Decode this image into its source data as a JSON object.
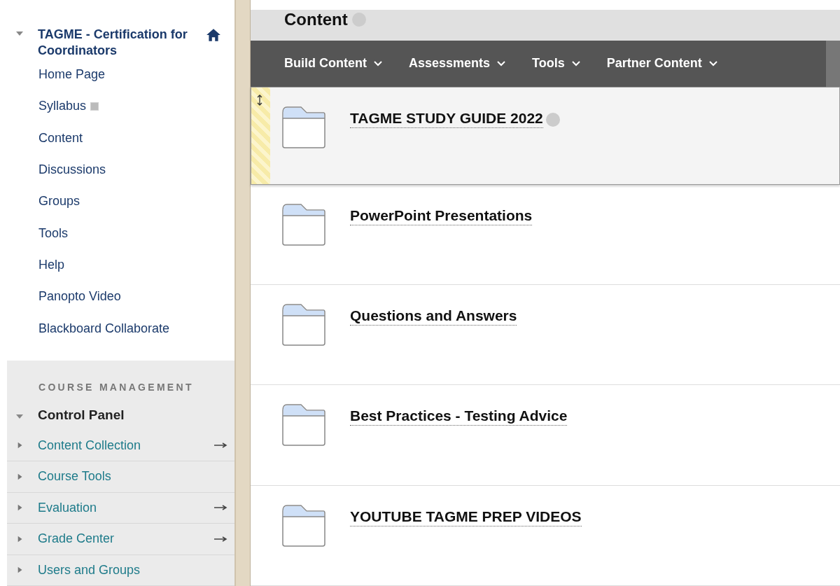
{
  "course": {
    "title": "TAGME - Certification for Coordinators",
    "expanded": true
  },
  "menu": [
    {
      "label": "Home Page",
      "marked": false
    },
    {
      "label": "Syllabus",
      "marked": true
    },
    {
      "label": "Content",
      "marked": false
    },
    {
      "label": "Discussions",
      "marked": false
    },
    {
      "label": "Groups",
      "marked": false
    },
    {
      "label": "Tools",
      "marked": false
    },
    {
      "label": "Help",
      "marked": false
    },
    {
      "label": "Panopto Video",
      "marked": false
    },
    {
      "label": "Blackboard Collaborate",
      "marked": false
    }
  ],
  "management": {
    "heading": "COURSE MANAGEMENT",
    "panel": {
      "label": "Control Panel",
      "expanded": true
    },
    "items": [
      {
        "label": "Content Collection",
        "expanded": false,
        "arrow": true
      },
      {
        "label": "Course Tools",
        "expanded": false,
        "arrow": false
      },
      {
        "label": "Evaluation",
        "expanded": false,
        "arrow": true
      },
      {
        "label": "Grade Center",
        "expanded": false,
        "arrow": true
      },
      {
        "label": "Users and Groups",
        "expanded": false,
        "arrow": false
      }
    ]
  },
  "page_title": "Content",
  "toolbar": [
    {
      "label": "Build Content"
    },
    {
      "label": "Assessments"
    },
    {
      "label": "Tools"
    },
    {
      "label": "Partner Content"
    }
  ],
  "items": [
    {
      "title": "TAGME STUDY GUIDE 2022",
      "selected": true
    },
    {
      "title": "PowerPoint Presentations",
      "selected": false
    },
    {
      "title": "Questions and Answers",
      "selected": false
    },
    {
      "title": "Best Practices - Testing Advice",
      "selected": false
    },
    {
      "title": "YOUTUBE TAGME PREP VIDEOS",
      "selected": false
    }
  ]
}
